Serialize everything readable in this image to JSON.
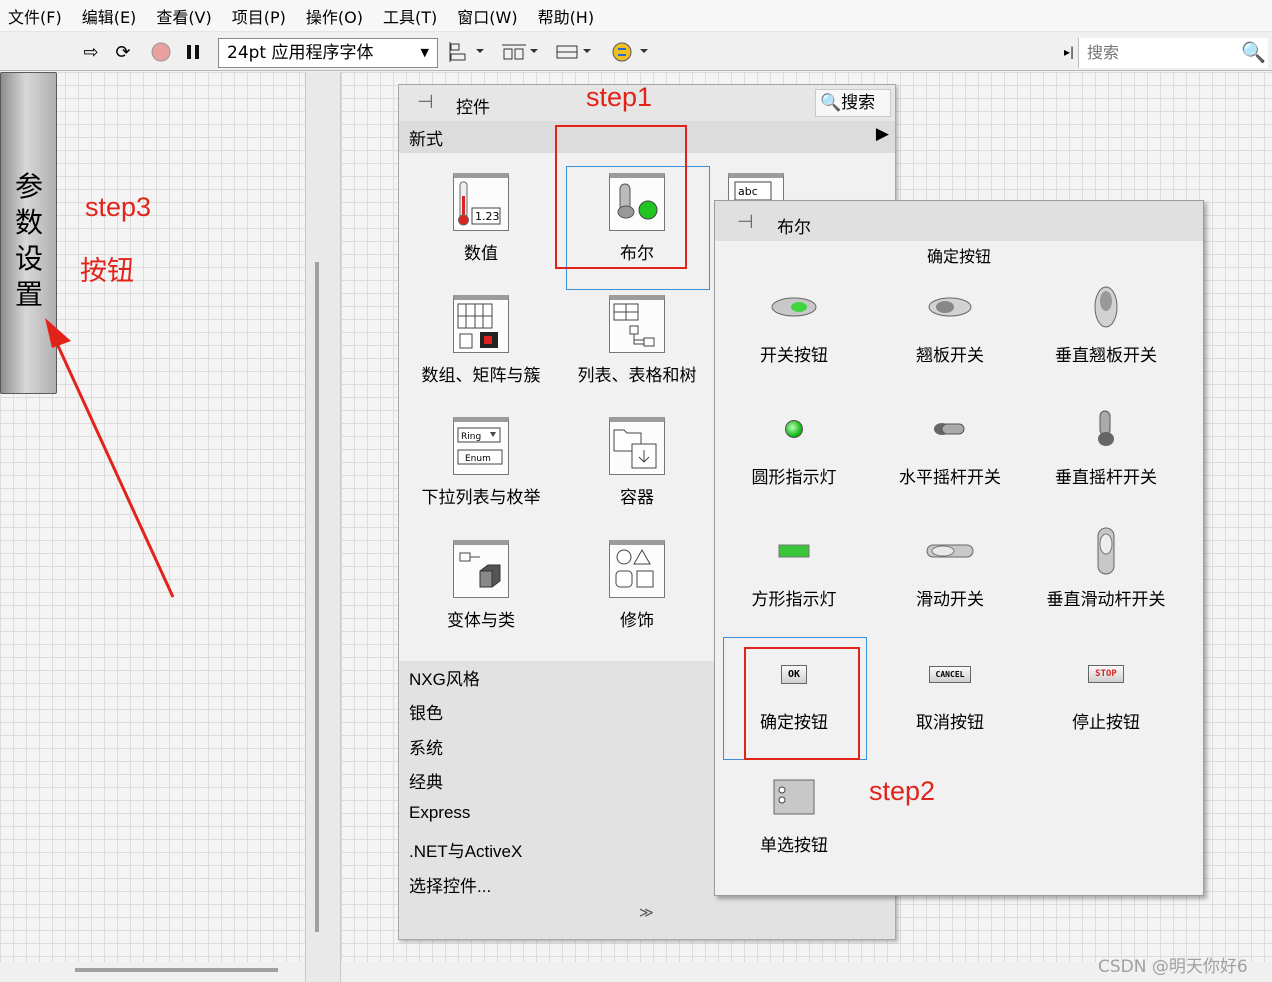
{
  "menu": [
    "文件(F)",
    "编辑(E)",
    "查看(V)",
    "项目(P)",
    "操作(O)",
    "工具(T)",
    "窗口(W)",
    "帮助(H)"
  ],
  "toolbar": {
    "font": "24pt 应用程序字体",
    "search_placeholder": "搜索"
  },
  "front_panel": {
    "param_button": "参数设置"
  },
  "annotations": {
    "step1": "step1",
    "step2": "step2",
    "step3": "step3",
    "button_note": "按钮",
    "color": "#e2231a"
  },
  "palette": {
    "title": "控件",
    "search": "搜索",
    "category": "新式",
    "items": [
      "数值",
      "布尔",
      "数组、矩阵与簇",
      "列表、表格和树",
      "下拉列表与枚举",
      "容器",
      "变体与类",
      "修饰"
    ],
    "partial_label": "abc",
    "list": [
      "NXG风格",
      "银色",
      "系统",
      "经典",
      "Express",
      ".NET与ActiveX",
      "选择控件..."
    ]
  },
  "bool_palette": {
    "title": "布尔",
    "tooltip": "确定按钮",
    "items": [
      "开关按钮",
      "翘板开关",
      "垂直翘板开关",
      "圆形指示灯",
      "水平摇杆开关",
      "垂直摇杆开关",
      "方形指示灯",
      "滑动开关",
      "垂直滑动杆开关",
      "确定按钮",
      "取消按钮",
      "停止按钮",
      "单选按钮"
    ],
    "button_texts": {
      "ok": "OK",
      "cancel": "CANCEL",
      "stop": "STOP"
    }
  },
  "watermark": "CSDN @明天你好6"
}
